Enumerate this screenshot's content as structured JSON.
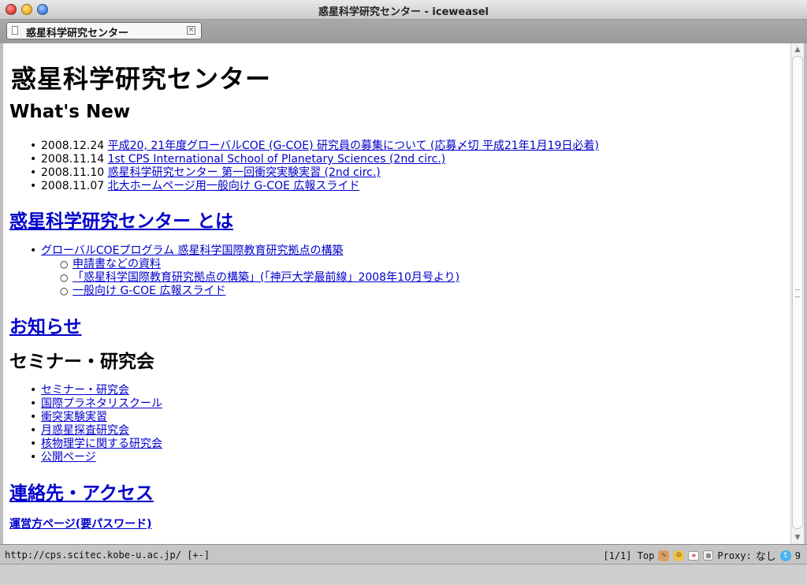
{
  "window": {
    "title": "惑星科学研究センター - iceweasel"
  },
  "tab": {
    "label": "惑星科学研究センター"
  },
  "page": {
    "title": "惑星科学研究センター",
    "whats_new": {
      "heading": "What's New",
      "items": [
        {
          "date": "2008.12.24",
          "link": "平成20, 21年度グローバルCOE (G-COE) 研究員の募集について (応募〆切 平成21年1月19日必着)"
        },
        {
          "date": "2008.11.14",
          "link": "1st CPS International School of Planetary Sciences (2nd circ.)"
        },
        {
          "date": "2008.11.10",
          "link": "惑星科学研究センター 第一回衝突実験実習 (2nd circ.)"
        },
        {
          "date": "2008.11.07",
          "link": "北大ホームページ用一般向け G-COE 広報スライド"
        }
      ]
    },
    "about": {
      "heading": "惑星科学研究センター とは",
      "item": "グローバルCOEプログラム 惑星科学国際教育研究拠点の構築",
      "subitems": [
        "申請書などの資料",
        "「惑星科学国際教育研究拠点の構築」(「神戸大学最前線」2008年10月号より)",
        "一般向け G-COE 広報スライド"
      ]
    },
    "news": {
      "heading": "お知らせ"
    },
    "seminar": {
      "heading": "セミナー・研究会",
      "items": [
        "セミナー・研究会",
        "国際プラネタリスクール",
        "衝突実験実習",
        "月惑星探査研究会",
        "核物理学に関する研究会",
        "公開ページ"
      ]
    },
    "contact": {
      "heading": "連絡先・アクセス"
    },
    "admin": {
      "link": "運営方ページ(要パスワード)"
    }
  },
  "status": {
    "url": "http://cps.scitec.kobe-u.ac.jp/ [+-]",
    "position": "[1/1] Top",
    "proxy_label": "Proxy:",
    "proxy_value": "なし",
    "count": "9"
  }
}
